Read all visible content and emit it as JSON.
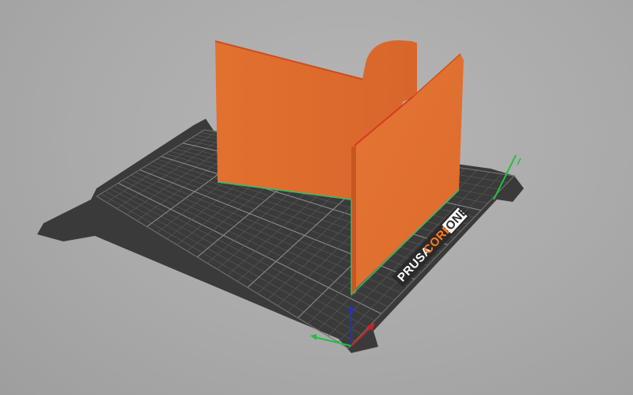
{
  "viewport": {
    "background_color": "#ababab",
    "bed": {
      "logo": {
        "prusa": "PRUSA",
        "core": "CORE",
        "one": "ONE"
      },
      "colors": {
        "plate": "#3a3a3a",
        "grid_line": "#5c5c5c",
        "grid_major": "#8a8a8a",
        "brand_orange": "#ff7a1f"
      }
    },
    "model": {
      "color": "#e06a2a",
      "highlight_color": "#ea7a36",
      "edge_color": "#c95520",
      "selection_edge": "#2fbf6a"
    },
    "axes": {
      "x_color": "#d02020",
      "y_color": "#20c040",
      "z_color": "#2030d0"
    }
  }
}
